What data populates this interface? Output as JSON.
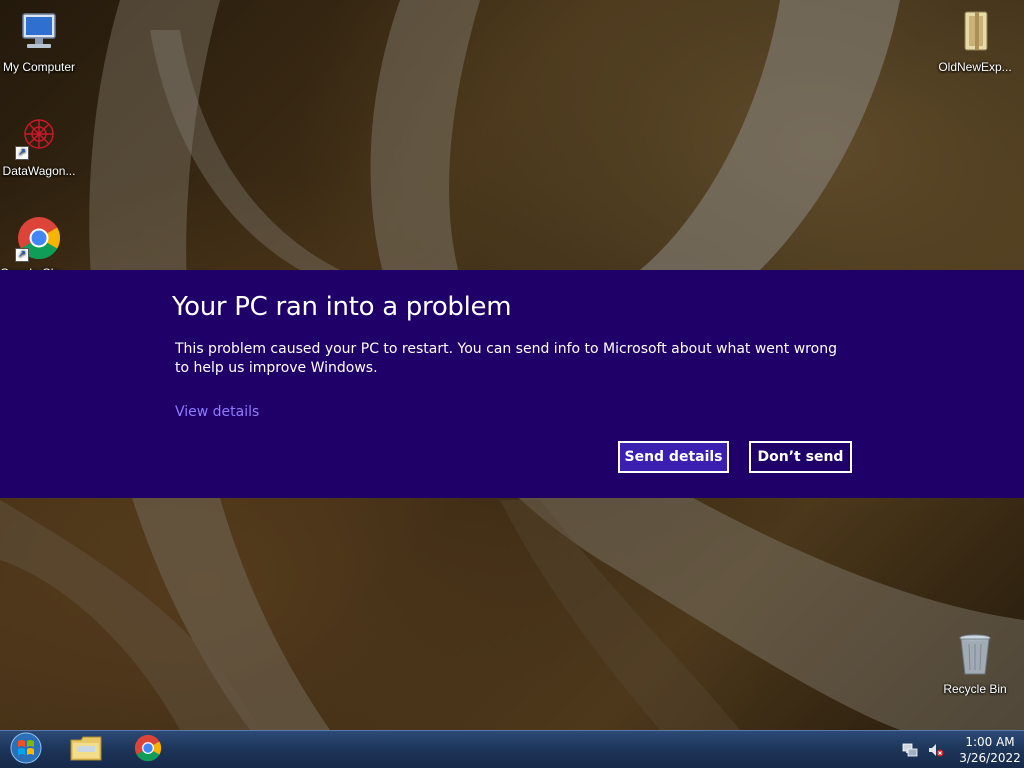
{
  "desktop": {
    "icons": [
      {
        "label": "My Computer",
        "icon": "computer-icon"
      },
      {
        "label": "DataWagon...",
        "icon": "datawagon-icon"
      },
      {
        "label": "Google Chrome",
        "icon": "chrome-icon"
      },
      {
        "label": "OldNewExp...",
        "icon": "folder-icon"
      },
      {
        "label": "Recycle Bin",
        "icon": "recycle-bin-icon"
      }
    ]
  },
  "error_banner": {
    "title": "Your PC ran into a problem",
    "message": "This problem caused your PC to restart. You can send info to Microsoft about what went wrong to help us improve Windows.",
    "view_details": "View details",
    "send_details": "Send details",
    "dont_send": "Don’t send",
    "background_color": "#1f0069",
    "link_color": "#8f7bff",
    "primary_button_color": "#3a1fb0"
  },
  "taskbar": {
    "start_icon": "windows-start-icon",
    "pinned": [
      {
        "name": "Windows Explorer",
        "icon": "explorer-folder-icon"
      },
      {
        "name": "Google Chrome",
        "icon": "chrome-icon"
      }
    ],
    "tray": {
      "network_icon": "network-icon",
      "volume_icon": "volume-muted-icon",
      "time": "1:00 AM",
      "date": "3/26/2022"
    }
  }
}
